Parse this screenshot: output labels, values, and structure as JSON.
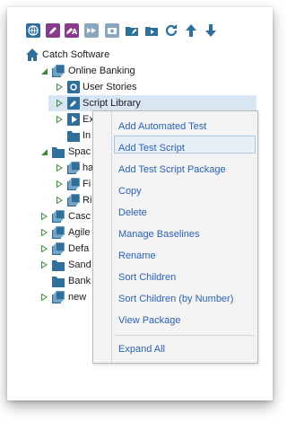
{
  "toolbar": {
    "icons": [
      "globe-icon",
      "pencil-icon",
      "rename-icon",
      "fast-forward-icon",
      "camera-icon",
      "folder-edit-icon",
      "folder-play-icon",
      "refresh-icon",
      "arrow-up-icon",
      "arrow-down-icon"
    ]
  },
  "tree": {
    "root": "Catch Software",
    "online_banking": "Online Banking",
    "user_stories": "User Stories",
    "script_library": "Script Library",
    "ex_partial": "Ex",
    "in_partial": "In",
    "spac_partial": "Spac",
    "ha_partial": "ha",
    "fi_partial": "Fi",
    "ri_partial": "Ri",
    "casc_partial": "Casc",
    "agile_partial": "Agile",
    "defa_partial": "Defa",
    "sand_partial": "Sand",
    "bank_partial": "Bank",
    "new_partial": "new"
  },
  "context_menu": {
    "items": [
      "Add Automated Test",
      "Add Test Script",
      "Add Test Script Package",
      "Copy",
      "Delete",
      "Manage Baselines",
      "Rename",
      "Sort Children",
      "Sort Children (by Number)",
      "View Package",
      "Expand All"
    ],
    "hovered_index": 1
  },
  "colors": {
    "menu_text": "#2c62b0",
    "selection_bg": "#d8e5f3",
    "folder": "#2f6f9a",
    "home": "#2f6f9a",
    "expanded_arrow": "#3a8a3a"
  }
}
